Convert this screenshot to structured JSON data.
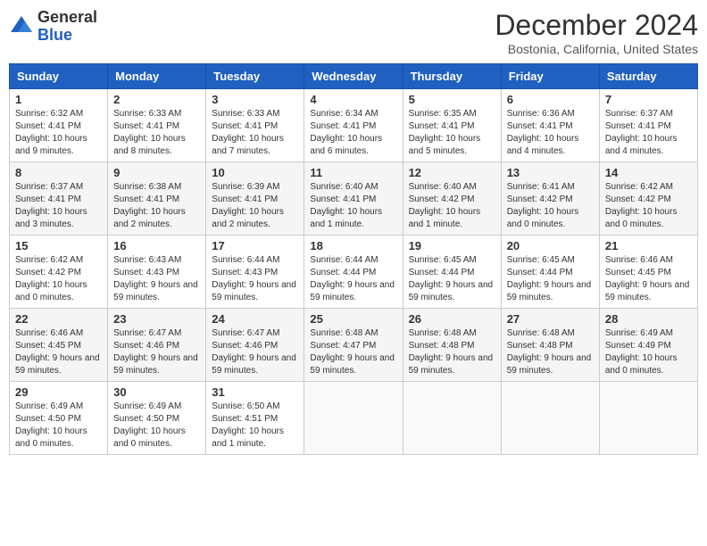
{
  "logo": {
    "general": "General",
    "blue": "Blue"
  },
  "header": {
    "month": "December 2024",
    "location": "Bostonia, California, United States"
  },
  "weekdays": [
    "Sunday",
    "Monday",
    "Tuesday",
    "Wednesday",
    "Thursday",
    "Friday",
    "Saturday"
  ],
  "weeks": [
    [
      {
        "day": "1",
        "sunrise": "6:32 AM",
        "sunset": "4:41 PM",
        "daylight": "10 hours and 9 minutes."
      },
      {
        "day": "2",
        "sunrise": "6:33 AM",
        "sunset": "4:41 PM",
        "daylight": "10 hours and 8 minutes."
      },
      {
        "day": "3",
        "sunrise": "6:33 AM",
        "sunset": "4:41 PM",
        "daylight": "10 hours and 7 minutes."
      },
      {
        "day": "4",
        "sunrise": "6:34 AM",
        "sunset": "4:41 PM",
        "daylight": "10 hours and 6 minutes."
      },
      {
        "day": "5",
        "sunrise": "6:35 AM",
        "sunset": "4:41 PM",
        "daylight": "10 hours and 5 minutes."
      },
      {
        "day": "6",
        "sunrise": "6:36 AM",
        "sunset": "4:41 PM",
        "daylight": "10 hours and 4 minutes."
      },
      {
        "day": "7",
        "sunrise": "6:37 AM",
        "sunset": "4:41 PM",
        "daylight": "10 hours and 4 minutes."
      }
    ],
    [
      {
        "day": "8",
        "sunrise": "6:37 AM",
        "sunset": "4:41 PM",
        "daylight": "10 hours and 3 minutes."
      },
      {
        "day": "9",
        "sunrise": "6:38 AM",
        "sunset": "4:41 PM",
        "daylight": "10 hours and 2 minutes."
      },
      {
        "day": "10",
        "sunrise": "6:39 AM",
        "sunset": "4:41 PM",
        "daylight": "10 hours and 2 minutes."
      },
      {
        "day": "11",
        "sunrise": "6:40 AM",
        "sunset": "4:41 PM",
        "daylight": "10 hours and 1 minute."
      },
      {
        "day": "12",
        "sunrise": "6:40 AM",
        "sunset": "4:42 PM",
        "daylight": "10 hours and 1 minute."
      },
      {
        "day": "13",
        "sunrise": "6:41 AM",
        "sunset": "4:42 PM",
        "daylight": "10 hours and 0 minutes."
      },
      {
        "day": "14",
        "sunrise": "6:42 AM",
        "sunset": "4:42 PM",
        "daylight": "10 hours and 0 minutes."
      }
    ],
    [
      {
        "day": "15",
        "sunrise": "6:42 AM",
        "sunset": "4:42 PM",
        "daylight": "10 hours and 0 minutes."
      },
      {
        "day": "16",
        "sunrise": "6:43 AM",
        "sunset": "4:43 PM",
        "daylight": "9 hours and 59 minutes."
      },
      {
        "day": "17",
        "sunrise": "6:44 AM",
        "sunset": "4:43 PM",
        "daylight": "9 hours and 59 minutes."
      },
      {
        "day": "18",
        "sunrise": "6:44 AM",
        "sunset": "4:44 PM",
        "daylight": "9 hours and 59 minutes."
      },
      {
        "day": "19",
        "sunrise": "6:45 AM",
        "sunset": "4:44 PM",
        "daylight": "9 hours and 59 minutes."
      },
      {
        "day": "20",
        "sunrise": "6:45 AM",
        "sunset": "4:44 PM",
        "daylight": "9 hours and 59 minutes."
      },
      {
        "day": "21",
        "sunrise": "6:46 AM",
        "sunset": "4:45 PM",
        "daylight": "9 hours and 59 minutes."
      }
    ],
    [
      {
        "day": "22",
        "sunrise": "6:46 AM",
        "sunset": "4:45 PM",
        "daylight": "9 hours and 59 minutes."
      },
      {
        "day": "23",
        "sunrise": "6:47 AM",
        "sunset": "4:46 PM",
        "daylight": "9 hours and 59 minutes."
      },
      {
        "day": "24",
        "sunrise": "6:47 AM",
        "sunset": "4:46 PM",
        "daylight": "9 hours and 59 minutes."
      },
      {
        "day": "25",
        "sunrise": "6:48 AM",
        "sunset": "4:47 PM",
        "daylight": "9 hours and 59 minutes."
      },
      {
        "day": "26",
        "sunrise": "6:48 AM",
        "sunset": "4:48 PM",
        "daylight": "9 hours and 59 minutes."
      },
      {
        "day": "27",
        "sunrise": "6:48 AM",
        "sunset": "4:48 PM",
        "daylight": "9 hours and 59 minutes."
      },
      {
        "day": "28",
        "sunrise": "6:49 AM",
        "sunset": "4:49 PM",
        "daylight": "10 hours and 0 minutes."
      }
    ],
    [
      {
        "day": "29",
        "sunrise": "6:49 AM",
        "sunset": "4:50 PM",
        "daylight": "10 hours and 0 minutes."
      },
      {
        "day": "30",
        "sunrise": "6:49 AM",
        "sunset": "4:50 PM",
        "daylight": "10 hours and 0 minutes."
      },
      {
        "day": "31",
        "sunrise": "6:50 AM",
        "sunset": "4:51 PM",
        "daylight": "10 hours and 1 minute."
      },
      null,
      null,
      null,
      null
    ]
  ],
  "labels": {
    "sunrise": "Sunrise:",
    "sunset": "Sunset:",
    "daylight": "Daylight:"
  }
}
